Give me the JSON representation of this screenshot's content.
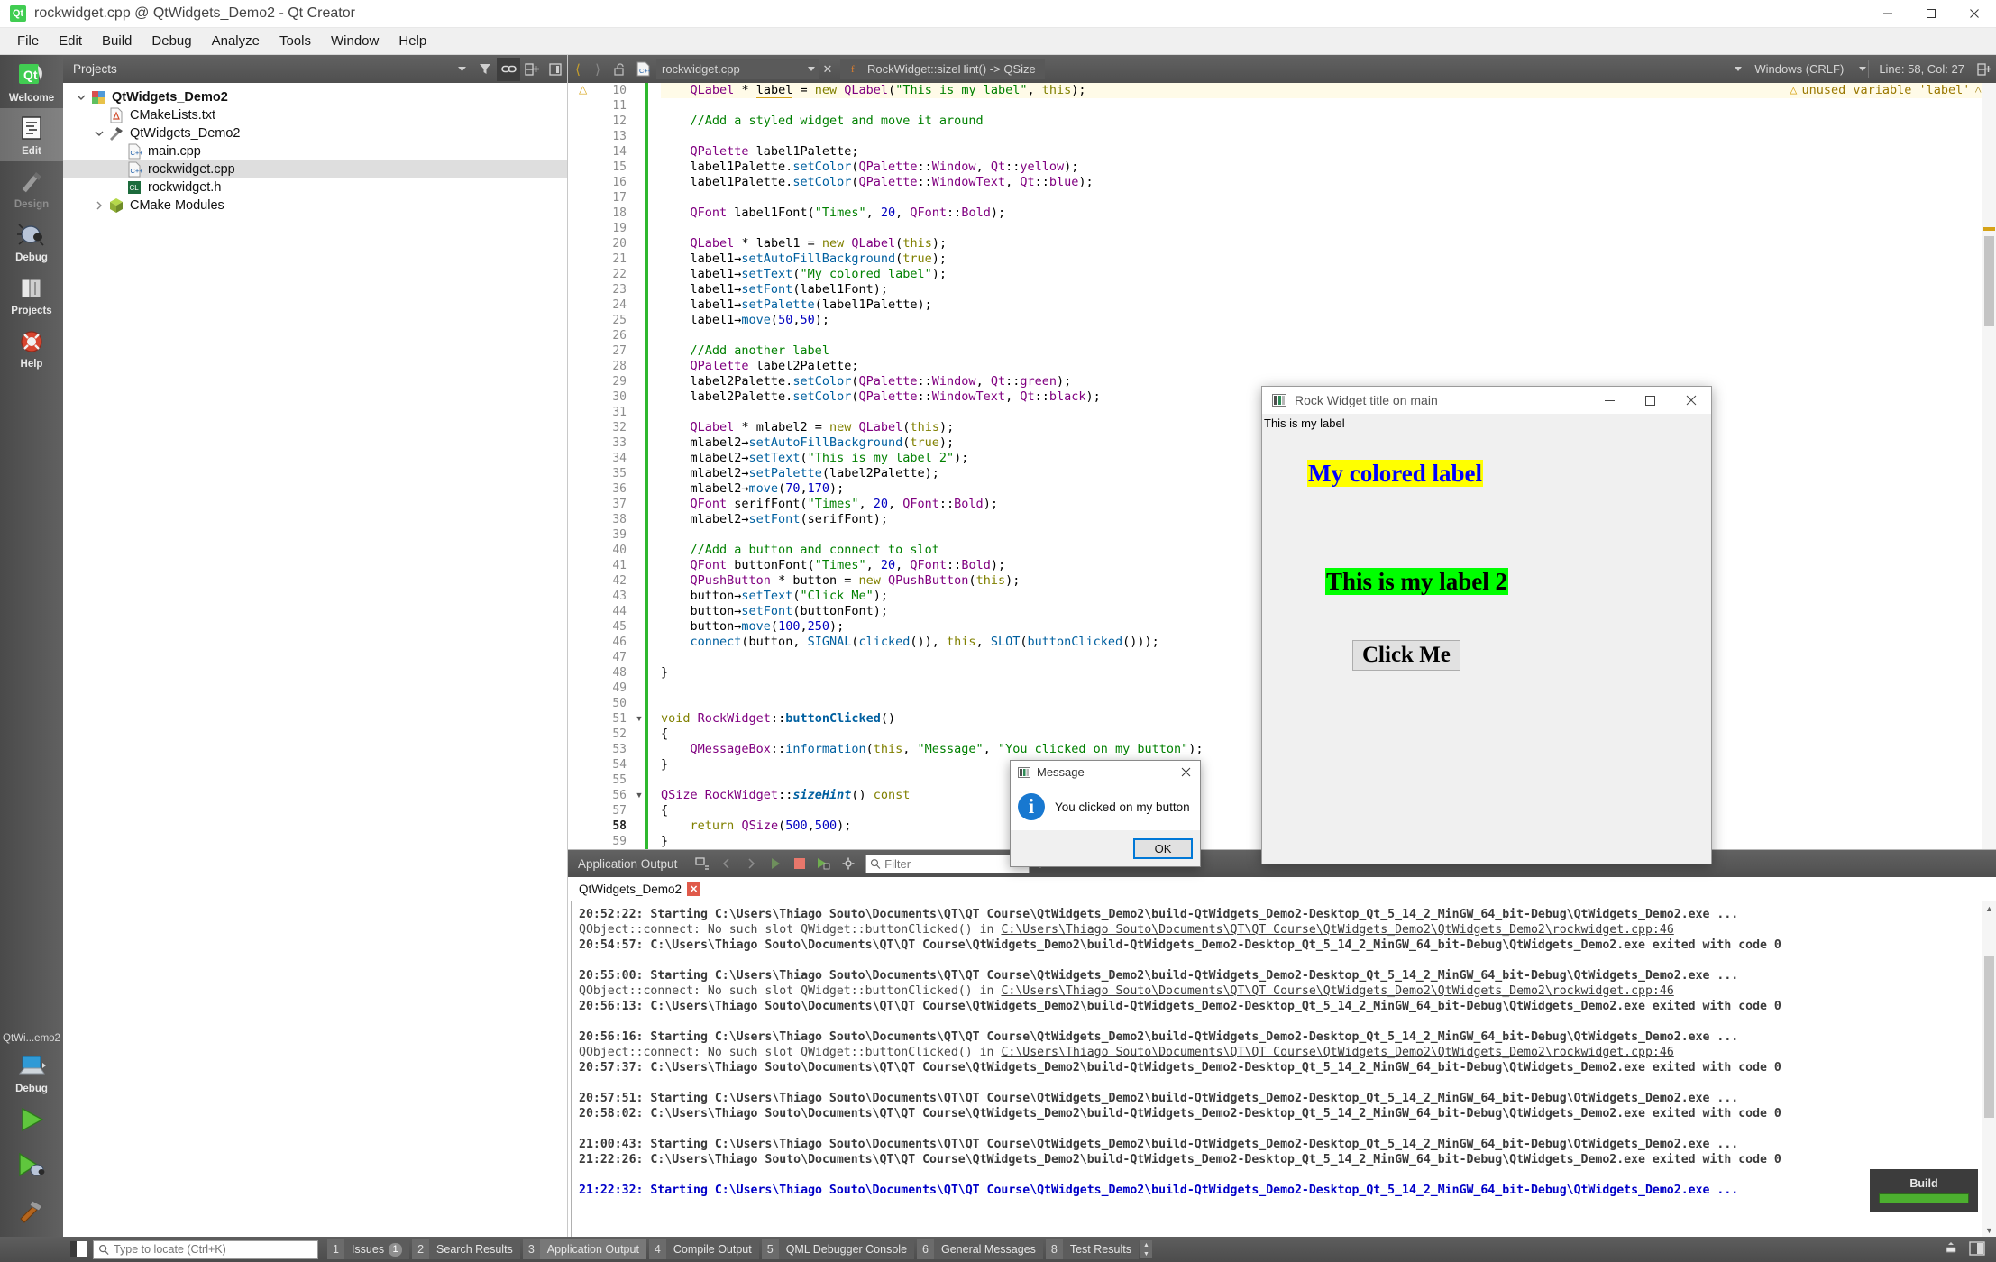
{
  "window": {
    "title": "rockwidget.cpp @ QtWidgets_Demo2 - Qt Creator",
    "app_icon": "qt-creator-icon",
    "minimize": "—",
    "maximize": "□",
    "close": "✕"
  },
  "menubar": {
    "items": [
      "File",
      "Edit",
      "Build",
      "Debug",
      "Analyze",
      "Tools",
      "Window",
      "Help"
    ]
  },
  "activity_bar": {
    "modes": [
      {
        "label": "Welcome",
        "icon": "qt-logo-icon",
        "state": "normal"
      },
      {
        "label": "Edit",
        "icon": "document-lines-icon",
        "state": "active"
      },
      {
        "label": "Design",
        "icon": "paintbrush-ruler-icon",
        "state": "disabled"
      },
      {
        "label": "Debug",
        "icon": "bug-icon",
        "state": "normal"
      },
      {
        "label": "Projects",
        "icon": "folders-icon",
        "state": "normal"
      },
      {
        "label": "Help",
        "icon": "lifebuoy-icon",
        "state": "normal"
      }
    ],
    "kit_label": "QtWi...emo2",
    "kit_mode": "Debug",
    "kit_icon": "computer-icon",
    "run_icon": "run-green-play-icon",
    "debug_icon": "start-debugging-icon",
    "build_icon": "hammer-build-icon"
  },
  "projects_panel": {
    "title": "Projects",
    "toolbar": [
      {
        "name": "filter-icon",
        "state": "off"
      },
      {
        "name": "link-synchronize-icon",
        "state": "on"
      },
      {
        "name": "split-add-icon",
        "state": "off"
      },
      {
        "name": "close-sidebar-icon",
        "state": "off"
      }
    ],
    "tree": [
      {
        "label": "QtWidgets_Demo2",
        "indent": 0,
        "twisty": "open",
        "icon": "project-icon",
        "bold": true,
        "selected": false
      },
      {
        "label": "CMakeLists.txt",
        "indent": 1,
        "twisty": "none",
        "icon": "cmake-file-icon",
        "bold": false,
        "selected": false
      },
      {
        "label": "QtWidgets_Demo2",
        "indent": 1,
        "twisty": "open",
        "icon": "build-target-icon",
        "bold": false,
        "selected": false
      },
      {
        "label": "main.cpp",
        "indent": 2,
        "twisty": "none",
        "icon": "cpp-file-icon",
        "bold": false,
        "selected": false
      },
      {
        "label": "rockwidget.cpp",
        "indent": 2,
        "twisty": "none",
        "icon": "cpp-file-icon",
        "bold": false,
        "selected": true
      },
      {
        "label": "rockwidget.h",
        "indent": 2,
        "twisty": "none",
        "icon": "header-file-icon",
        "bold": false,
        "selected": false
      },
      {
        "label": "CMake Modules",
        "indent": 1,
        "twisty": "closed",
        "icon": "package-icon",
        "bold": false,
        "selected": false
      }
    ]
  },
  "editor": {
    "toolbar": {
      "back_icon": "back-arrow-icon",
      "forward_icon": "forward-arrow-icon",
      "lock_icon": "unlocked-icon",
      "file_icon": "cpp-file-icon",
      "file_name": "rockwidget.cpp",
      "close_label": "✕",
      "symbol_icon": "function-symbol-icon",
      "symbol_name": "RockWidget::sizeHint() -> QSize",
      "line_ending": "Windows (CRLF)",
      "cursor_position": "Line: 58, Col: 27",
      "split_icon": "split-editor-icon"
    },
    "warning_banner": {
      "icon": "warning-triangle-icon",
      "text": "unused variable 'label'",
      "collapse": "˄"
    },
    "first_line_number": 10,
    "current_line": 58,
    "lines": [
      {
        "n": 10,
        "warn": true,
        "hl": true,
        "fold": "",
        "html": "    <span class='ty'>QLabel</span> <span class='pl'>*</span> <span class='uline'>label</span> = <span class='k'>new</span> <span class='ty'>QLabel</span>(<span class='st'>\"This is my label\"</span>, <span class='k'>this</span>);"
      },
      {
        "n": 11,
        "html": ""
      },
      {
        "n": 12,
        "html": "    <span class='cm'>//Add a styled widget and move it around</span>"
      },
      {
        "n": 13,
        "html": ""
      },
      {
        "n": 14,
        "html": "    <span class='ty'>QPalette</span> label1Palette;"
      },
      {
        "n": 15,
        "html": "    label1Palette.<span class='fn'>setColor</span>(<span class='ty'>QPalette</span>::<span class='ty'>Window</span>, <span class='ty'>Qt</span>::<span class='ty'>yellow</span>);"
      },
      {
        "n": 16,
        "html": "    label1Palette.<span class='fn'>setColor</span>(<span class='ty'>QPalette</span>::<span class='ty'>WindowText</span>, <span class='ty'>Qt</span>::<span class='ty'>blue</span>);"
      },
      {
        "n": 17,
        "html": ""
      },
      {
        "n": 18,
        "html": "    <span class='ty'>QFont</span> label1Font(<span class='st'>\"Times\"</span>, <span class='nm'>20</span>, <span class='ty'>QFont</span>::<span class='ty'>Bold</span>);"
      },
      {
        "n": 19,
        "html": ""
      },
      {
        "n": 20,
        "html": "    <span class='ty'>QLabel</span> <span class='pl'>*</span> label1 = <span class='k'>new</span> <span class='ty'>QLabel</span>(<span class='k'>this</span>);"
      },
      {
        "n": 21,
        "html": "    label1→<span class='fn'>setAutoFillBackground</span>(<span class='k'>true</span>);"
      },
      {
        "n": 22,
        "html": "    label1→<span class='fn'>setText</span>(<span class='st'>\"My colored label\"</span>);"
      },
      {
        "n": 23,
        "html": "    label1→<span class='fn'>setFont</span>(label1Font);"
      },
      {
        "n": 24,
        "html": "    label1→<span class='fn'>setPalette</span>(label1Palette);"
      },
      {
        "n": 25,
        "html": "    label1→<span class='fn'>move</span>(<span class='nm'>50</span>,<span class='nm'>50</span>);"
      },
      {
        "n": 26,
        "html": ""
      },
      {
        "n": 27,
        "html": "    <span class='cm'>//Add another label</span>"
      },
      {
        "n": 28,
        "html": "    <span class='ty'>QPalette</span> label2Palette;"
      },
      {
        "n": 29,
        "html": "    label2Palette.<span class='fn'>setColor</span>(<span class='ty'>QPalette</span>::<span class='ty'>Window</span>, <span class='ty'>Qt</span>::<span class='ty'>green</span>);"
      },
      {
        "n": 30,
        "html": "    label2Palette.<span class='fn'>setColor</span>(<span class='ty'>QPalette</span>::<span class='ty'>WindowText</span>, <span class='ty'>Qt</span>::<span class='ty'>black</span>);"
      },
      {
        "n": 31,
        "html": ""
      },
      {
        "n": 32,
        "html": "    <span class='ty'>QLabel</span> <span class='pl'>*</span> mlabel2 = <span class='k'>new</span> <span class='ty'>QLabel</span>(<span class='k'>this</span>);"
      },
      {
        "n": 33,
        "html": "    mlabel2→<span class='fn'>setAutoFillBackground</span>(<span class='k'>true</span>);"
      },
      {
        "n": 34,
        "html": "    mlabel2→<span class='fn'>setText</span>(<span class='st'>\"This is my label 2\"</span>);"
      },
      {
        "n": 35,
        "html": "    mlabel2→<span class='fn'>setPalette</span>(label2Palette);"
      },
      {
        "n": 36,
        "html": "    mlabel2→<span class='fn'>move</span>(<span class='nm'>70</span>,<span class='nm'>170</span>);"
      },
      {
        "n": 37,
        "html": "    <span class='ty'>QFont</span> serifFont(<span class='st'>\"Times\"</span>, <span class='nm'>20</span>, <span class='ty'>QFont</span>::<span class='ty'>Bold</span>);"
      },
      {
        "n": 38,
        "html": "    mlabel2→<span class='fn'>setFont</span>(serifFont);"
      },
      {
        "n": 39,
        "html": ""
      },
      {
        "n": 40,
        "html": "    <span class='cm'>//Add a button and connect to slot</span>"
      },
      {
        "n": 41,
        "html": "    <span class='ty'>QFont</span> buttonFont(<span class='st'>\"Times\"</span>, <span class='nm'>20</span>, <span class='ty'>QFont</span>::<span class='ty'>Bold</span>);"
      },
      {
        "n": 42,
        "html": "    <span class='ty'>QPushButton</span> <span class='pl'>*</span> button = <span class='k'>new</span> <span class='ty'>QPushButton</span>(<span class='k'>this</span>);"
      },
      {
        "n": 43,
        "html": "    button→<span class='fn'>setText</span>(<span class='st'>\"Click Me\"</span>);"
      },
      {
        "n": 44,
        "html": "    button→<span class='fn'>setFont</span>(buttonFont);"
      },
      {
        "n": 45,
        "html": "    button→<span class='fn'>move</span>(<span class='nm'>100</span>,<span class='nm'>250</span>);"
      },
      {
        "n": 46,
        "html": "    <span class='fn'>connect</span>(button, <span class='fn'>SIGNAL</span>(<span class='fn'>clicked</span>()), <span class='k'>this</span>, <span class='fn'>SLOT</span>(<span class='fn'>buttonClicked</span>()));"
      },
      {
        "n": 47,
        "html": ""
      },
      {
        "n": 48,
        "html": "}"
      },
      {
        "n": 49,
        "html": ""
      },
      {
        "n": 50,
        "html": ""
      },
      {
        "n": 51,
        "fold": "▼",
        "html": "<span class='k'>void</span> <span class='ty'>RockWidget</span>::<span class='fn bd'>buttonClicked</span>()"
      },
      {
        "n": 52,
        "html": "{"
      },
      {
        "n": 53,
        "html": "    <span class='ty'>QMessageBox</span>::<span class='fn'>information</span>(<span class='k'>this</span>, <span class='st'>\"Message\"</span>, <span class='st'>\"You clicked on my button\"</span>);"
      },
      {
        "n": 54,
        "html": "}"
      },
      {
        "n": 55,
        "html": ""
      },
      {
        "n": 56,
        "fold": "▼",
        "html": "<span class='ty'>QSize</span> <span class='ty'>RockWidget</span>::<span class='fn bd it'>sizeHint</span>() <span class='k'>const</span>"
      },
      {
        "n": 57,
        "html": "{"
      },
      {
        "n": 58,
        "cur": true,
        "html": "    <span class='k'>return</span> <span class='ty'>QSize</span>(<span class='nm'>500</span>,<span class='nm'>500</span>);"
      },
      {
        "n": 59,
        "html": "}"
      },
      {
        "n": 60,
        "html": ""
      }
    ]
  },
  "application_output": {
    "title": "Application Output",
    "toolbar_icons": [
      "attach-debugger-icon",
      "prev-item-icon",
      "next-item-icon",
      "rerun-icon",
      "stop-icon",
      "run-with-output-icon",
      "settings-gear-icon"
    ],
    "filter": {
      "icon": "search-icon",
      "placeholder": "Filter",
      "value": ""
    },
    "zoom_in": "+",
    "zoom_out": "−",
    "tab": {
      "label": "QtWidgets_Demo2",
      "close": "✕"
    },
    "log": [
      {
        "style": "b",
        "text": "20:52:22: Starting C:\\Users\\Thiago Souto\\Documents\\QT\\QT Course\\QtWidgets_Demo2\\build-QtWidgets_Demo2-Desktop_Qt_5_14_2_MinGW_64_bit-Debug\\QtWidgets_Demo2.exe ..."
      },
      {
        "style": "n",
        "text": "QObject::connect: No such slot QWidget::buttonClicked() in ",
        "link": "C:\\Users\\Thiago Souto\\Documents\\QT\\QT Course\\QtWidgets_Demo2\\QtWidgets_Demo2\\rockwidget.cpp:46"
      },
      {
        "style": "b",
        "text": "20:54:57: C:\\Users\\Thiago Souto\\Documents\\QT\\QT Course\\QtWidgets_Demo2\\build-QtWidgets_Demo2-Desktop_Qt_5_14_2_MinGW_64_bit-Debug\\QtWidgets_Demo2.exe exited with code 0"
      },
      {
        "style": "n",
        "text": ""
      },
      {
        "style": "b",
        "text": "20:55:00: Starting C:\\Users\\Thiago Souto\\Documents\\QT\\QT Course\\QtWidgets_Demo2\\build-QtWidgets_Demo2-Desktop_Qt_5_14_2_MinGW_64_bit-Debug\\QtWidgets_Demo2.exe ..."
      },
      {
        "style": "n",
        "text": "QObject::connect: No such slot QWidget::buttonClicked() in ",
        "link": "C:\\Users\\Thiago Souto\\Documents\\QT\\QT Course\\QtWidgets_Demo2\\QtWidgets_Demo2\\rockwidget.cpp:46"
      },
      {
        "style": "b",
        "text": "20:56:13: C:\\Users\\Thiago Souto\\Documents\\QT\\QT Course\\QtWidgets_Demo2\\build-QtWidgets_Demo2-Desktop_Qt_5_14_2_MinGW_64_bit-Debug\\QtWidgets_Demo2.exe exited with code 0"
      },
      {
        "style": "n",
        "text": ""
      },
      {
        "style": "b",
        "text": "20:56:16: Starting C:\\Users\\Thiago Souto\\Documents\\QT\\QT Course\\QtWidgets_Demo2\\build-QtWidgets_Demo2-Desktop_Qt_5_14_2_MinGW_64_bit-Debug\\QtWidgets_Demo2.exe ..."
      },
      {
        "style": "n",
        "text": "QObject::connect: No such slot QWidget::buttonClicked() in ",
        "link": "C:\\Users\\Thiago Souto\\Documents\\QT\\QT Course\\QtWidgets_Demo2\\QtWidgets_Demo2\\rockwidget.cpp:46"
      },
      {
        "style": "b",
        "text": "20:57:37: C:\\Users\\Thiago Souto\\Documents\\QT\\QT Course\\QtWidgets_Demo2\\build-QtWidgets_Demo2-Desktop_Qt_5_14_2_MinGW_64_bit-Debug\\QtWidgets_Demo2.exe exited with code 0"
      },
      {
        "style": "n",
        "text": ""
      },
      {
        "style": "b",
        "text": "20:57:51: Starting C:\\Users\\Thiago Souto\\Documents\\QT\\QT Course\\QtWidgets_Demo2\\build-QtWidgets_Demo2-Desktop_Qt_5_14_2_MinGW_64_bit-Debug\\QtWidgets_Demo2.exe ..."
      },
      {
        "style": "b",
        "text": "20:58:02: C:\\Users\\Thiago Souto\\Documents\\QT\\QT Course\\QtWidgets_Demo2\\build-QtWidgets_Demo2-Desktop_Qt_5_14_2_MinGW_64_bit-Debug\\QtWidgets_Demo2.exe exited with code 0"
      },
      {
        "style": "n",
        "text": ""
      },
      {
        "style": "b",
        "text": "21:00:43: Starting C:\\Users\\Thiago Souto\\Documents\\QT\\QT Course\\QtWidgets_Demo2\\build-QtWidgets_Demo2-Desktop_Qt_5_14_2_MinGW_64_bit-Debug\\QtWidgets_Demo2.exe ..."
      },
      {
        "style": "b",
        "text": "21:22:26: C:\\Users\\Thiago Souto\\Documents\\QT\\QT Course\\QtWidgets_Demo2\\build-QtWidgets_Demo2-Desktop_Qt_5_14_2_MinGW_64_bit-Debug\\QtWidgets_Demo2.exe exited with code 0"
      },
      {
        "style": "n",
        "text": ""
      },
      {
        "style": "blue",
        "text": "21:22:32: Starting C:\\Users\\Thiago Souto\\Documents\\QT\\QT Course\\QtWidgets_Demo2\\build-QtWidgets_Demo2-Desktop_Qt_5_14_2_MinGW_64_bit-Debug\\QtWidgets_Demo2.exe ..."
      }
    ]
  },
  "status_bar": {
    "sidebar_toggle_icon": "toggle-sidebar-icon",
    "locator": {
      "icon": "search-icon",
      "placeholder": "Type to locate (Ctrl+K)",
      "value": ""
    },
    "panes": [
      {
        "num": "1",
        "label": "Issues",
        "badge": "1",
        "active": false
      },
      {
        "num": "2",
        "label": "Search Results",
        "badge": "",
        "active": false
      },
      {
        "num": "3",
        "label": "Application Output",
        "badge": "",
        "active": true
      },
      {
        "num": "4",
        "label": "Compile Output",
        "badge": "",
        "active": false
      },
      {
        "num": "5",
        "label": "QML Debugger Console",
        "badge": "",
        "active": false
      },
      {
        "num": "6",
        "label": "General Messages",
        "badge": "",
        "active": false
      },
      {
        "num": "8",
        "label": "Test Results",
        "badge": "",
        "active": false
      }
    ],
    "right_icons": [
      "progress-details-icon",
      "output-pane-toggle-icon"
    ]
  },
  "build_progress": {
    "title": "Build",
    "percent": 100
  },
  "rock_widget_window": {
    "title": "Rock Widget title on main",
    "icon": "app-window-icon",
    "minimize": "—",
    "maximize": "□",
    "close": "✕",
    "plain_label": "This is my label",
    "colored_label": {
      "text": "My colored label",
      "bg": "#ffff00",
      "fg": "#0000ff"
    },
    "label2": {
      "text": "This is my label 2",
      "bg": "#00ff00",
      "fg": "#000000"
    },
    "button": "Click Me"
  },
  "message_dialog": {
    "title": "Message",
    "icon": "app-window-icon",
    "close": "✕",
    "info_icon": "information-icon",
    "info_glyph": "i",
    "text": "You clicked on my button",
    "ok_button": "OK"
  }
}
